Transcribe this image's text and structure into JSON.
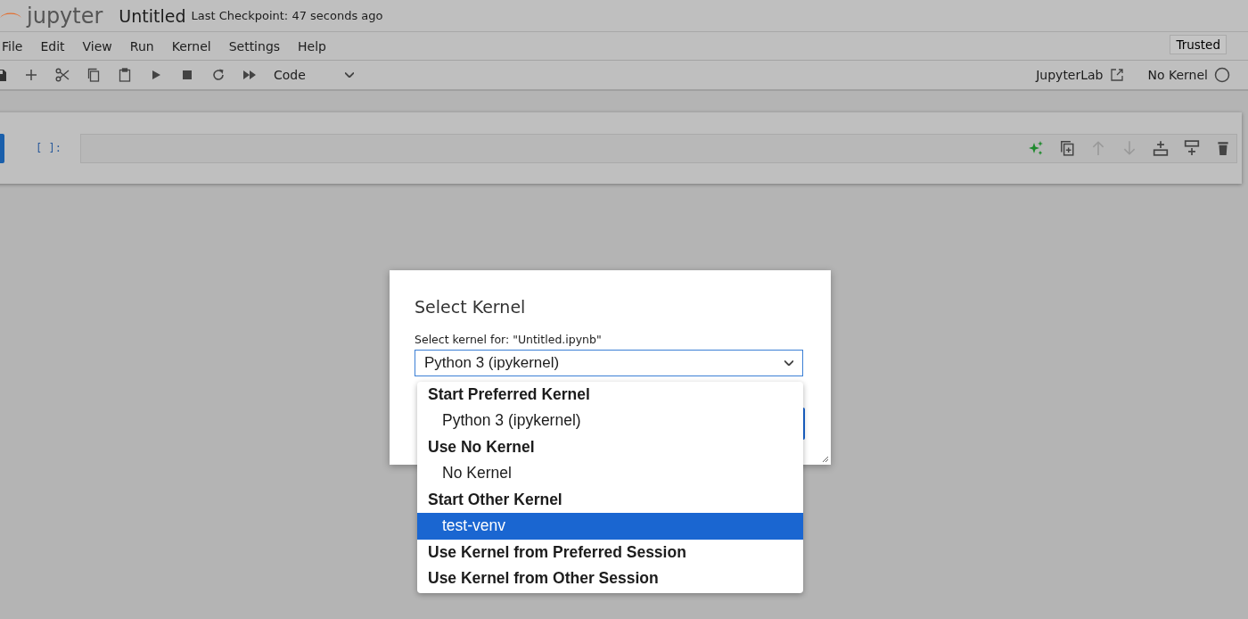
{
  "header": {
    "logo_text": "jupyter",
    "title": "Untitled",
    "checkpoint": "Last Checkpoint: 47 seconds ago"
  },
  "menu": [
    "File",
    "Edit",
    "View",
    "Run",
    "Kernel",
    "Settings",
    "Help"
  ],
  "trusted": "Trusted",
  "toolbar": {
    "cell_type": "Code",
    "jupyterlab": "JupyterLab",
    "kernel_status": "No Kernel"
  },
  "cell": {
    "prompt": "[ ]:"
  },
  "dialog": {
    "title": "Select Kernel",
    "label": "Select kernel for: \"Untitled.ipynb\"",
    "select_value": "Python 3 (ipykernel)",
    "options": [
      {
        "kind": "group",
        "label": "Start Preferred Kernel",
        "selected": false
      },
      {
        "kind": "option",
        "label": "Python 3 (ipykernel)",
        "selected": false
      },
      {
        "kind": "group",
        "label": "Use No Kernel",
        "selected": false
      },
      {
        "kind": "option",
        "label": "No Kernel",
        "selected": false
      },
      {
        "kind": "group",
        "label": "Start Other Kernel",
        "selected": false
      },
      {
        "kind": "option",
        "label": "test-venv",
        "selected": true
      },
      {
        "kind": "group",
        "label": "Use Kernel from Preferred Session",
        "selected": false
      },
      {
        "kind": "group",
        "label": "Use Kernel from Other Session",
        "selected": false
      }
    ]
  }
}
